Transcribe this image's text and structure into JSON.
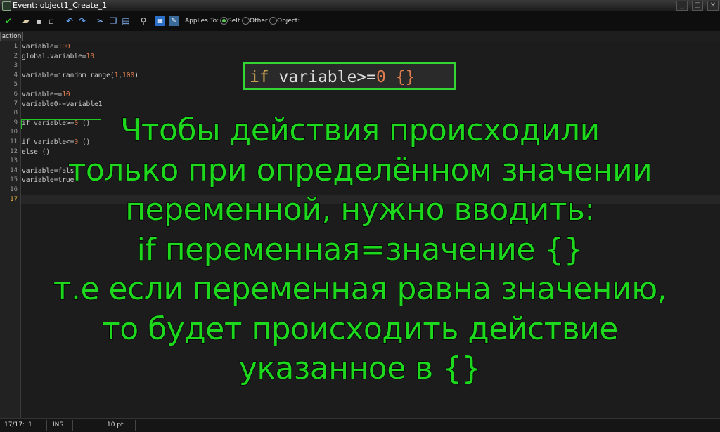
{
  "window": {
    "title": "Event: object1_Create_1",
    "buttons": [
      "_",
      "□",
      "✕"
    ]
  },
  "toolbar": {
    "applies_to_label": "Applies To:",
    "options": [
      {
        "label": "Self",
        "selected": true
      },
      {
        "label": "Other",
        "selected": false
      },
      {
        "label": "Object:",
        "selected": false
      }
    ]
  },
  "tab": {
    "label": "action"
  },
  "editor": {
    "line_numbers": [
      "1",
      "2",
      "3",
      "4",
      "5",
      "6",
      "7",
      "8",
      "9",
      "10",
      "11",
      "12",
      "13",
      "14",
      "15",
      "16",
      "17"
    ],
    "lines": [
      "variable=100",
      "global.variable=10",
      "",
      "variable=irandom_range(1,100)",
      "",
      "variable+=10",
      "variable0-=variable1",
      "",
      "if variable>=0 ()",
      "",
      "if variable<=0 ()",
      "else ()",
      "",
      "variable=false",
      "variable=true",
      "",
      ""
    ],
    "current_line": "17"
  },
  "callout": {
    "code": "if variable>=0 {}"
  },
  "overlay": {
    "lines": [
      "Чтобы действия происходили",
      "только при определённом значении",
      "переменной, нужно вводить:",
      "if переменная=значение {}",
      "т.е если переменная равна значению,",
      "то будет происходить действие",
      "указанное в {}"
    ],
    "color": "#1dd81d"
  },
  "status": {
    "position": "17/17:",
    "col": "1",
    "mode": "INS",
    "font_size": "10 pt"
  }
}
